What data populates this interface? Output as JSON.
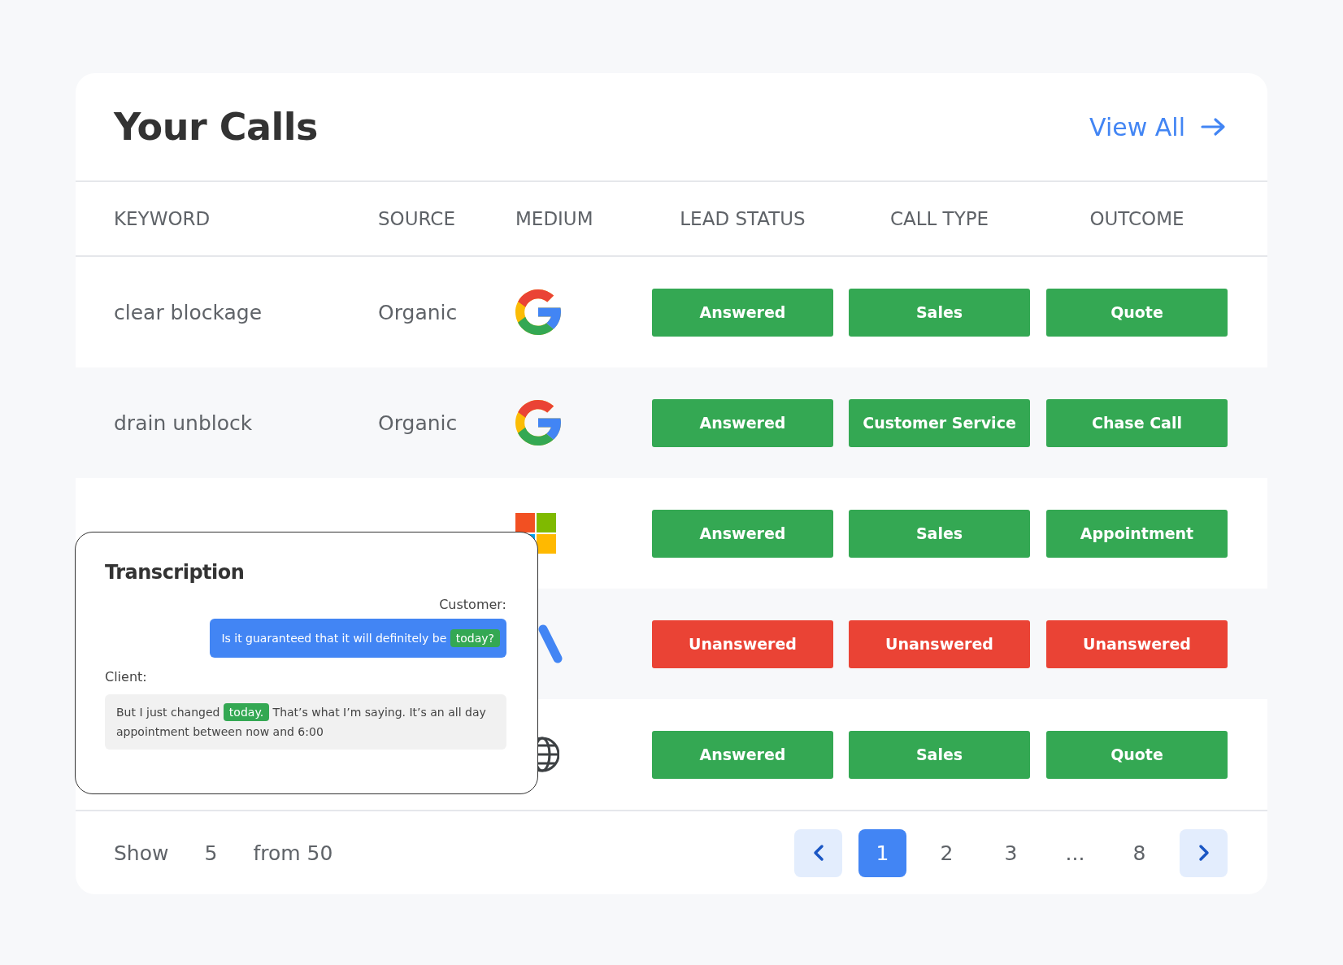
{
  "title": "Your Calls",
  "view_all": "View All",
  "columns": [
    "KEYWORD",
    "SOURCE",
    "MEDIUM",
    "LEAD STATUS",
    "CALL TYPE",
    "OUTCOME"
  ],
  "rows": [
    {
      "keyword": "clear blockage",
      "source": "Organic",
      "medium": {
        "kind": "google"
      },
      "lead_status": {
        "label": "Answered",
        "color": "#34a853"
      },
      "call_type": {
        "label": "Sales",
        "color": "#34a853"
      },
      "outcome": {
        "label": "Quote",
        "color": "#34a853"
      }
    },
    {
      "keyword": "drain unblock",
      "source": "Organic",
      "medium": {
        "kind": "google"
      },
      "lead_status": {
        "label": "Answered",
        "color": "#34a853"
      },
      "call_type": {
        "label": "Customer Service",
        "color": "#34a853"
      },
      "outcome": {
        "label": "Chase Call",
        "color": "#34a853"
      }
    },
    {
      "medium": {
        "kind": "microsoft"
      },
      "lead_status": {
        "label": "Answered",
        "color": "#34a853"
      },
      "call_type": {
        "label": "Sales",
        "color": "#34a853"
      },
      "outcome": {
        "label": "Appointment",
        "color": "#34a853"
      }
    },
    {
      "medium": {
        "kind": "ads"
      },
      "lead_status": {
        "label": "Unanswered",
        "color": "#ea4335"
      },
      "call_type": {
        "label": "Unanswered",
        "color": "#ea4335"
      },
      "outcome": {
        "label": "Unanswered",
        "color": "#ea4335"
      }
    },
    {
      "medium": {
        "kind": "web"
      },
      "lead_status": {
        "label": "Answered",
        "color": "#34a853"
      },
      "call_type": {
        "label": "Sales",
        "color": "#34a853"
      },
      "outcome": {
        "label": "Quote",
        "color": "#34a853"
      }
    }
  ],
  "footer": {
    "show": "Show",
    "count": "5",
    "total": "from 50"
  },
  "pagination": {
    "pages": [
      {
        "label": "1",
        "selected": true
      },
      {
        "label": "2",
        "selected": false
      },
      {
        "label": "3",
        "selected": false
      },
      {
        "label": "...",
        "selected": false
      },
      {
        "label": "8",
        "selected": false
      }
    ]
  },
  "transcription": {
    "title": "Transcription",
    "customer_label": "Customer:",
    "customer_message": [
      {
        "text": "Is it guaranteed that it will definitely be ",
        "highlight": false
      },
      {
        "text": "today?",
        "highlight": true
      }
    ],
    "client_label": "Client:",
    "client_message": [
      {
        "text": "But I just changed ",
        "highlight": false
      },
      {
        "text": "today.",
        "highlight": true
      },
      {
        "text": " That’s what I’m saying. It’s an all day appointment between now and 6:00",
        "highlight": false
      }
    ]
  }
}
